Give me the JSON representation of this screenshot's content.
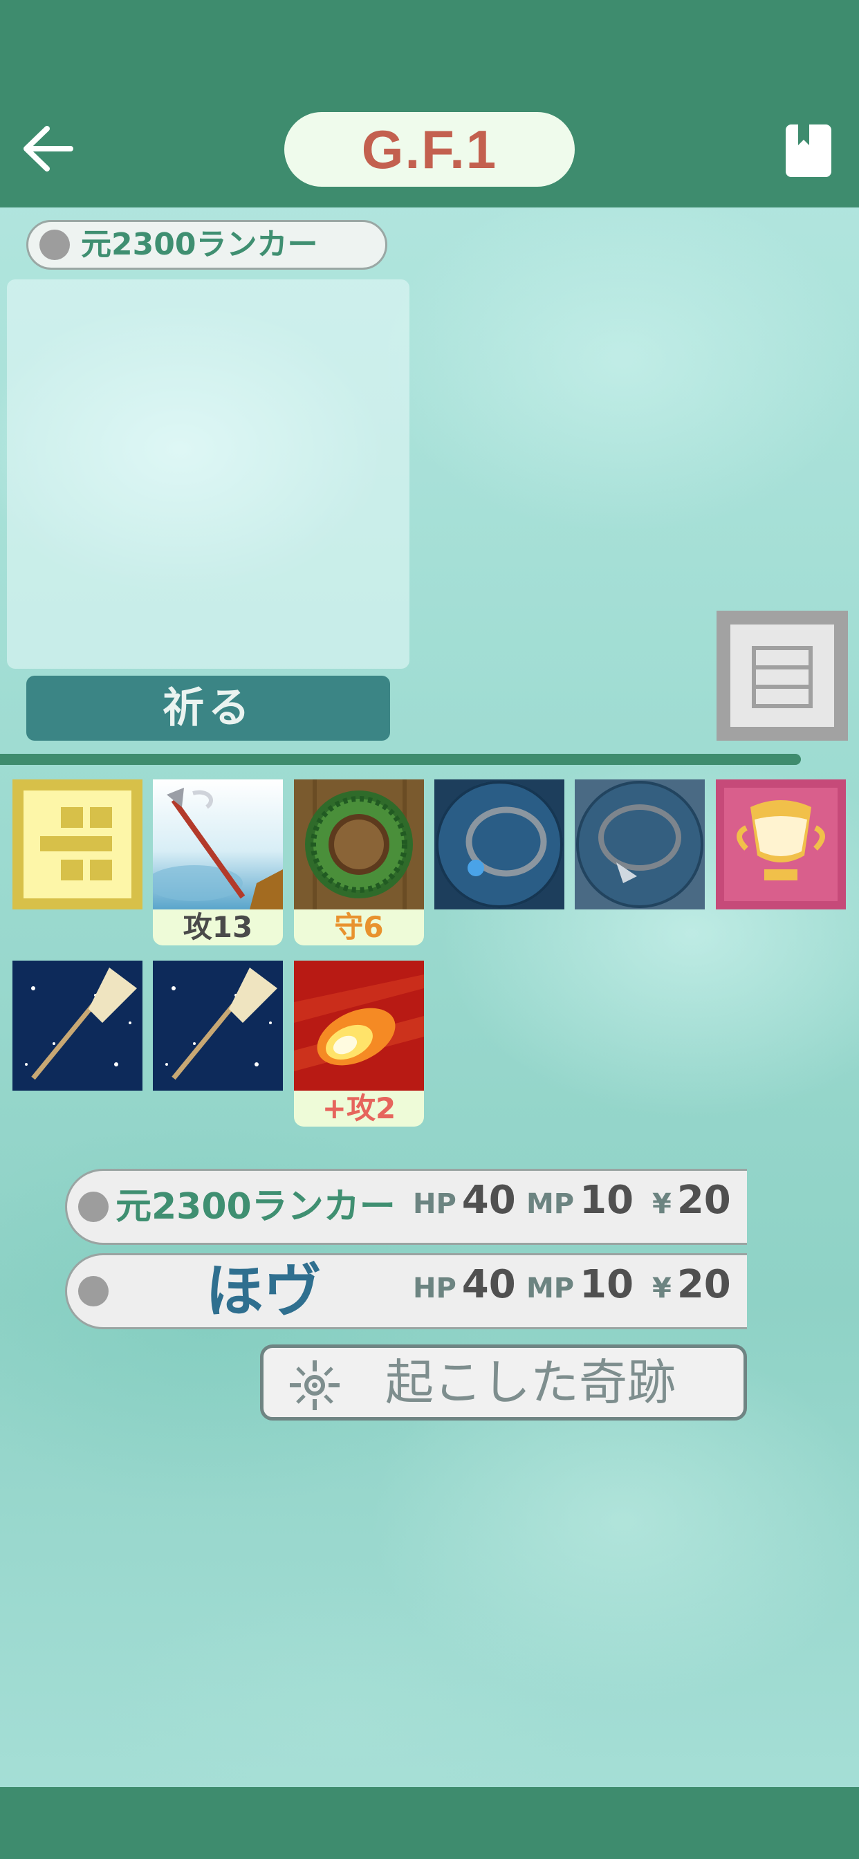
{
  "header": {
    "title": "G.F.1",
    "back_icon": "arrow-left",
    "bookmark_icon": "bookmark"
  },
  "profile": {
    "name_tag": "元2300ランカー",
    "pray_button": "祈る",
    "document_icon": "document"
  },
  "items": [
    {
      "name": "gold-rune",
      "label": ""
    },
    {
      "name": "spear",
      "label": "攻13"
    },
    {
      "name": "wreath-shield",
      "label": "守6"
    },
    {
      "name": "ring",
      "label": ""
    },
    {
      "name": "winged-ring",
      "label": ""
    },
    {
      "name": "golden-goblet",
      "label": ""
    },
    {
      "name": "magic-broom",
      "label": ""
    },
    {
      "name": "magic-broom",
      "label": ""
    },
    {
      "name": "fireball",
      "label": "+攻2"
    }
  ],
  "status_rows": [
    {
      "name": "元2300ランカー",
      "hp_label": "HP",
      "hp": "40",
      "mp_label": "MP",
      "mp": "10",
      "yen_label": "¥",
      "yen": "20"
    },
    {
      "name": "ほヴ",
      "hp_label": "HP",
      "hp": "40",
      "mp_label": "MP",
      "mp": "10",
      "yen_label": "¥",
      "yen": "20"
    }
  ],
  "miracle_button": "起こした奇跡",
  "colors": {
    "header": "#3e8c6e",
    "title": "#c3604f",
    "pray_button": "#3b8585",
    "attack_label": "#4a4a4a",
    "defense_label": "#e8922e",
    "bonus_label": "#e6645c"
  }
}
